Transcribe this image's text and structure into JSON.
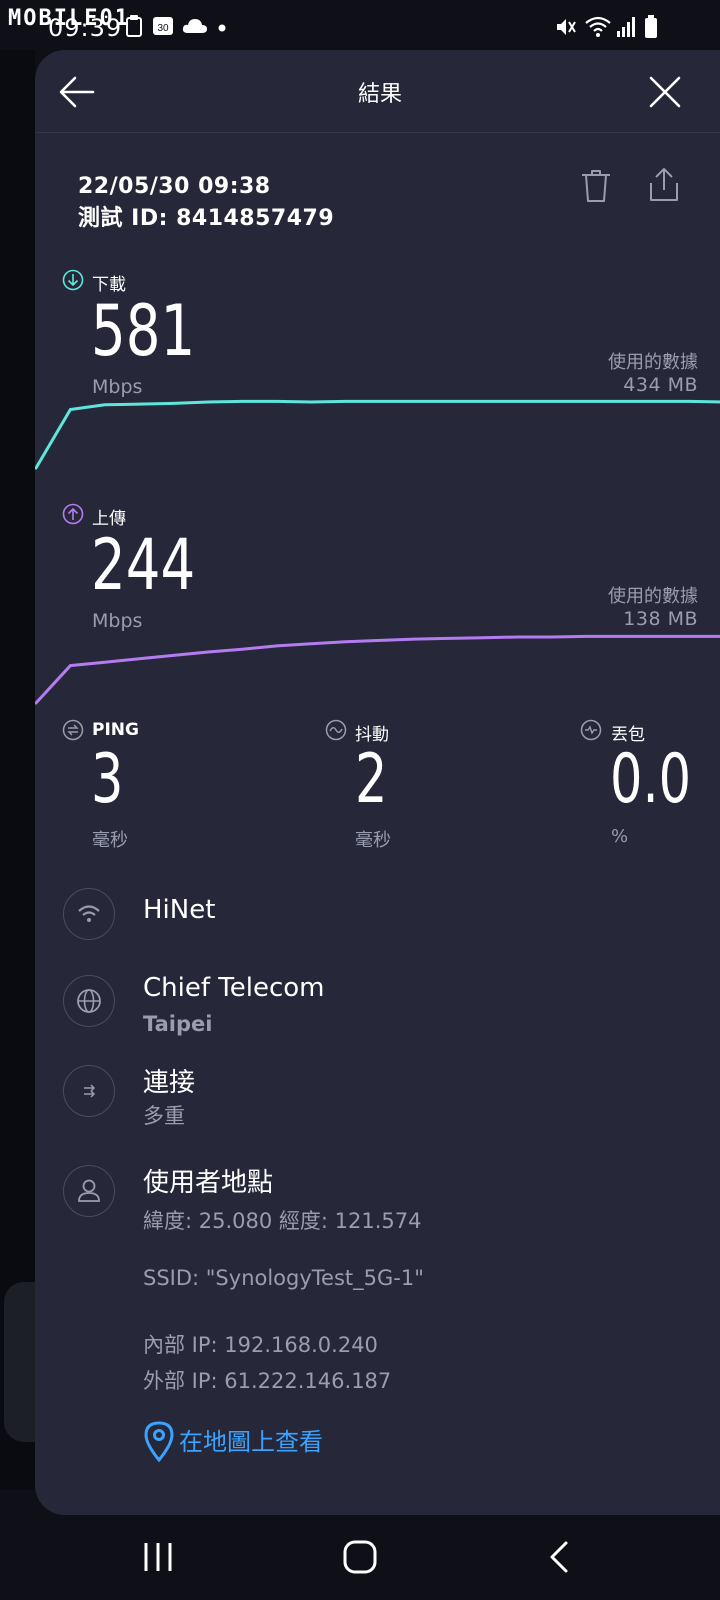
{
  "status_bar": {
    "time": "09:39",
    "watermark": "MOBILE01",
    "calendar_day": "30"
  },
  "header": {
    "title": "結果"
  },
  "meta": {
    "date": "22/05/30 09:38",
    "test_id_label": "測試 ID:",
    "test_id": "8414857479"
  },
  "download": {
    "label": "下載",
    "value": "581",
    "unit": "Mbps",
    "used_label": "使用的數據",
    "used_value": "434 MB",
    "color": "#5fe6dc",
    "samples": [
      0.0,
      0.86,
      0.93,
      0.94,
      0.95,
      0.97,
      0.98,
      0.98,
      0.97,
      0.98,
      0.98,
      0.98,
      0.98,
      0.98,
      0.98,
      0.98,
      0.98,
      0.98,
      0.98,
      0.98,
      0.97
    ]
  },
  "upload": {
    "label": "上傳",
    "value": "244",
    "unit": "Mbps",
    "used_label": "使用的數據",
    "used_value": "138 MB",
    "color": "#b57cf2",
    "samples": [
      0.0,
      0.55,
      0.6,
      0.65,
      0.7,
      0.75,
      0.79,
      0.84,
      0.87,
      0.9,
      0.92,
      0.94,
      0.95,
      0.96,
      0.97,
      0.97,
      0.98,
      0.98,
      0.98,
      0.98,
      0.98
    ]
  },
  "ping": {
    "label": "PING",
    "value": "3",
    "unit": "毫秒"
  },
  "jitter": {
    "label": "抖動",
    "value": "2",
    "unit": "毫秒"
  },
  "loss": {
    "label": "丟包",
    "value": "0.0",
    "unit": "%"
  },
  "isp": {
    "name": "HiNet"
  },
  "server": {
    "name": "Chief Telecom",
    "location": "Taipei"
  },
  "connection": {
    "title": "連接",
    "value": "多重"
  },
  "user_location": {
    "title": "使用者地點",
    "coords": "緯度: 25.080 經度: 121.574",
    "ssid": "SSID: \"SynologyTest_5G-1\"",
    "internal_ip": "內部 IP: 192.168.0.240",
    "external_ip": "外部 IP: 61.222.146.187"
  },
  "map_link": "在地圖上查看"
}
